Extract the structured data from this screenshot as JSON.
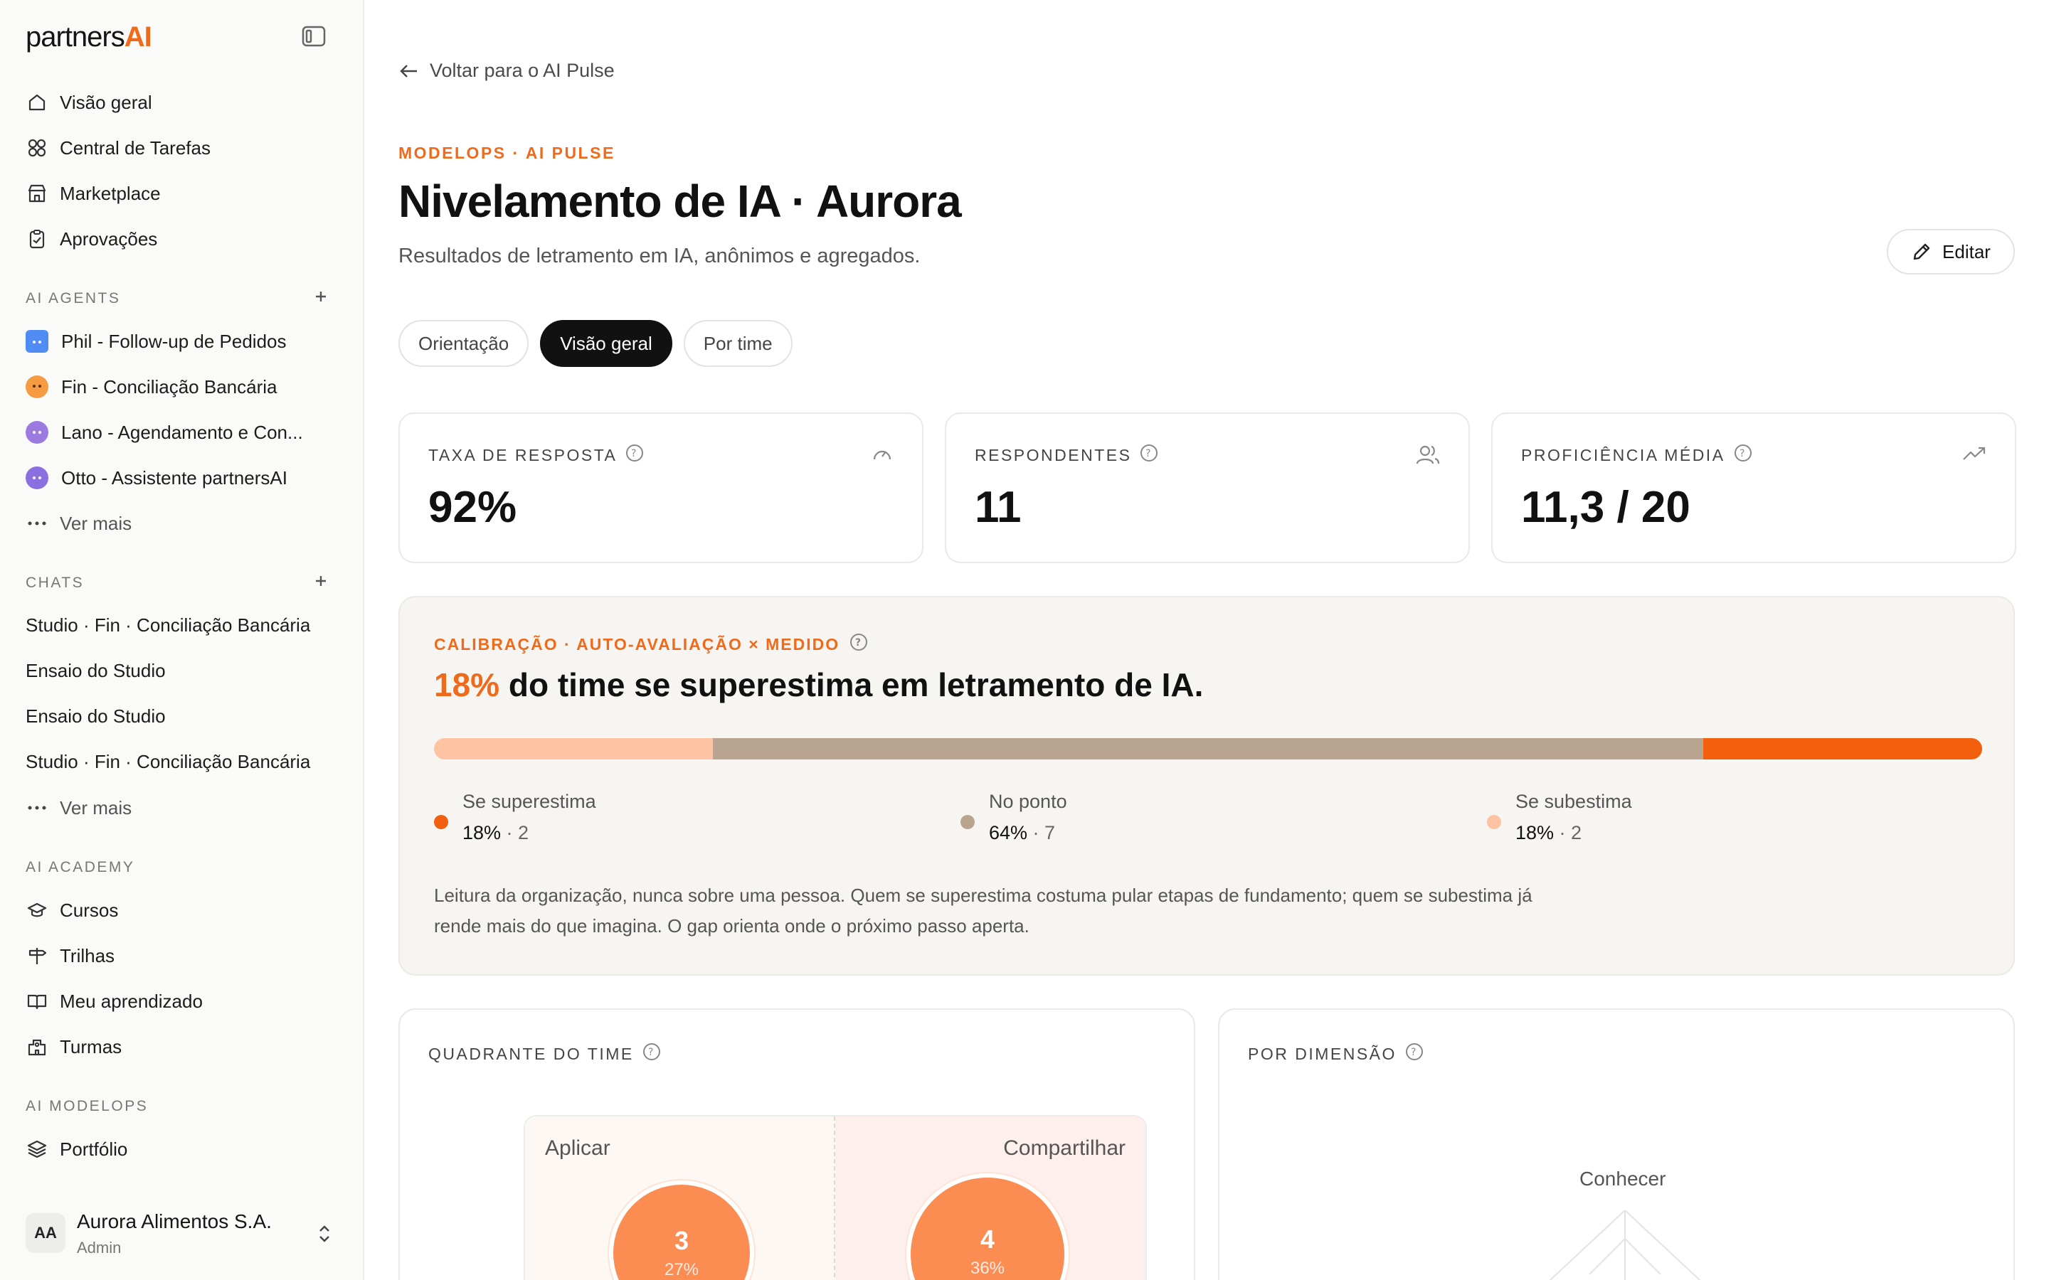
{
  "sidebar": {
    "brand_main": "partners",
    "brand_accent": "AI",
    "nav": [
      {
        "label": "Visão geral",
        "icon": "home-icon"
      },
      {
        "label": "Central de Tarefas",
        "icon": "grid-icon"
      },
      {
        "label": "Marketplace",
        "icon": "store-icon"
      },
      {
        "label": "Aprovações",
        "icon": "clipboard-check-icon"
      }
    ],
    "agents_label": "AI AGENTS",
    "agents": [
      {
        "label": "Phil - Follow-up de Pedidos",
        "color": "#4f8df5"
      },
      {
        "label": "Fin - Conciliação Bancária",
        "color": "#f59b42"
      },
      {
        "label": "Lano - Agendamento e Con...",
        "color": "#9b7be0"
      },
      {
        "label": "Otto - Assistente partnersAI",
        "color": "#8a6fe0"
      }
    ],
    "agents_more": "Ver mais",
    "chats_label": "CHATS",
    "chats": [
      "Studio · Fin · Conciliação Bancária",
      "Ensaio do Studio",
      "Ensaio do Studio",
      "Studio · Fin · Conciliação Bancária"
    ],
    "chats_more": "Ver mais",
    "academy_label": "AI ACADEMY",
    "academy": [
      {
        "label": "Cursos",
        "icon": "graduation-cap-icon"
      },
      {
        "label": "Trilhas",
        "icon": "signpost-icon"
      },
      {
        "label": "Meu aprendizado",
        "icon": "book-open-icon"
      },
      {
        "label": "Turmas",
        "icon": "school-icon"
      }
    ],
    "modelops_label": "AI MODELOPS",
    "modelops": [
      {
        "label": "Portfólio",
        "icon": "layers-icon"
      }
    ],
    "org": {
      "initials": "AA",
      "name": "Aurora Alimentos S.A.",
      "role": "Admin"
    }
  },
  "main": {
    "back_label": "Voltar para o AI Pulse",
    "eyebrow": "MODELOPS · AI PULSE",
    "title": "Nivelamento de IA · Aurora",
    "subtitle": "Resultados de letramento em IA, anônimos e agregados.",
    "edit_label": "Editar",
    "tabs": [
      "Orientação",
      "Visão geral",
      "Por time"
    ],
    "active_tab": "Visão geral",
    "kpis": [
      {
        "label": "TAXA DE RESPOSTA",
        "value": "92%",
        "icon": "gauge-icon"
      },
      {
        "label": "RESPONDENTES",
        "value": "11",
        "icon": "users-icon"
      },
      {
        "label": "PROFICIÊNCIA MÉDIA",
        "value": "11,3 / 20",
        "icon": "trending-up-icon"
      }
    ],
    "calibration": {
      "eyebrow": "CALIBRAÇÃO · AUTO-AVALIAÇÃO × MEDIDO",
      "headline_pct": "18%",
      "headline_rest": " do time se superestima em letramento de IA.",
      "segments": [
        {
          "name": "Se subestima",
          "share": 0.18,
          "color": "#fdc3a3"
        },
        {
          "name": "No ponto",
          "share": 0.64,
          "color": "#b8a48f"
        },
        {
          "name": "Se superestima",
          "share": 0.18,
          "color": "#f2600f"
        }
      ],
      "legend": [
        {
          "label": "Se superestima",
          "pct": "18%",
          "count": " · 2",
          "color": "#f2600f"
        },
        {
          "label": "No ponto",
          "pct": "64%",
          "count": " · 7",
          "color": "#b8a48f"
        },
        {
          "label": "Se subestima",
          "pct": "18%",
          "count": " · 2",
          "color": "#fdc3a3"
        }
      ],
      "note": "Leitura da organização, nunca sobre uma pessoa. Quem se superestima costuma pular etapas de fundamento; quem se subestima já rende mais do que imagina. O gap orienta onde o próximo passo aperta."
    },
    "quadrant": {
      "label": "QUADRANTE DO TIME",
      "cells": [
        {
          "name": "Aplicar",
          "count": "3",
          "pct": "27%"
        },
        {
          "name": "Compartilhar",
          "count": "4",
          "pct": "36%"
        }
      ]
    },
    "dimension": {
      "label": "POR DIMENSÃO",
      "axis_top": "Conhecer"
    }
  }
}
